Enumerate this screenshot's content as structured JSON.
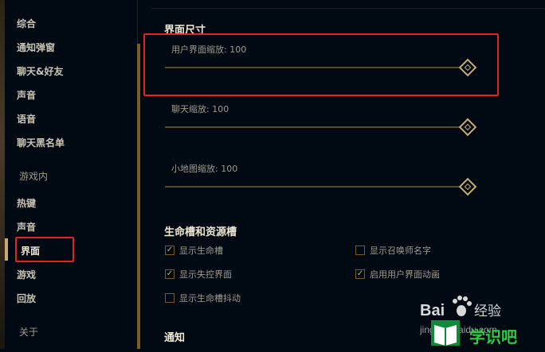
{
  "sidebar": {
    "items": [
      {
        "label": "综合"
      },
      {
        "label": "通知弹窗"
      },
      {
        "label": "聊天&好友"
      },
      {
        "label": "声音"
      },
      {
        "label": "语音"
      },
      {
        "label": "聊天黑名单"
      }
    ],
    "ingame_header": "游戏内",
    "ingame_items": [
      {
        "label": "热键"
      },
      {
        "label": "声音"
      },
      {
        "label": "界面"
      },
      {
        "label": "游戏"
      },
      {
        "label": "回放"
      }
    ],
    "about": "关于"
  },
  "interface_size": {
    "title": "界面尺寸",
    "sliders": [
      {
        "label": "用户界面缩放: 100",
        "value": 100,
        "max": 100
      },
      {
        "label": "聊天缩放: 100",
        "value": 100,
        "max": 100
      },
      {
        "label": "小地图缩放: 100",
        "value": 100,
        "max": 100
      }
    ]
  },
  "healthbars": {
    "title": "生命槽和资源槽",
    "options": [
      {
        "label": "显示生命槽",
        "checked": true
      },
      {
        "label": "显示召唤师名字",
        "checked": false
      },
      {
        "label": "显示失控界面",
        "checked": true
      },
      {
        "label": "启用用户界面动画",
        "checked": true
      },
      {
        "label": "显示生命槽抖动",
        "checked": false
      }
    ]
  },
  "notifications": {
    "title": "通知"
  },
  "watermark": {
    "brand": "Bai",
    "brand2": "经验",
    "url": "jingyan.baidu.com",
    "site": "学识吧"
  },
  "colors": {
    "accent": "#c8aa6e",
    "highlight": "#e0241f"
  }
}
